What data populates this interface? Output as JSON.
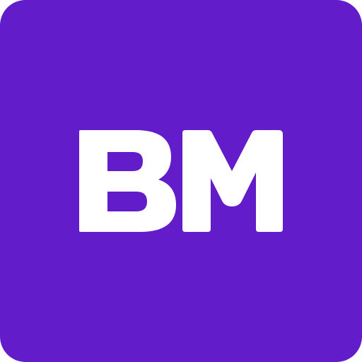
{
  "icon": {
    "monogram": "BM",
    "background_color": "#621CC9",
    "text_color": "#FFFFFF"
  }
}
